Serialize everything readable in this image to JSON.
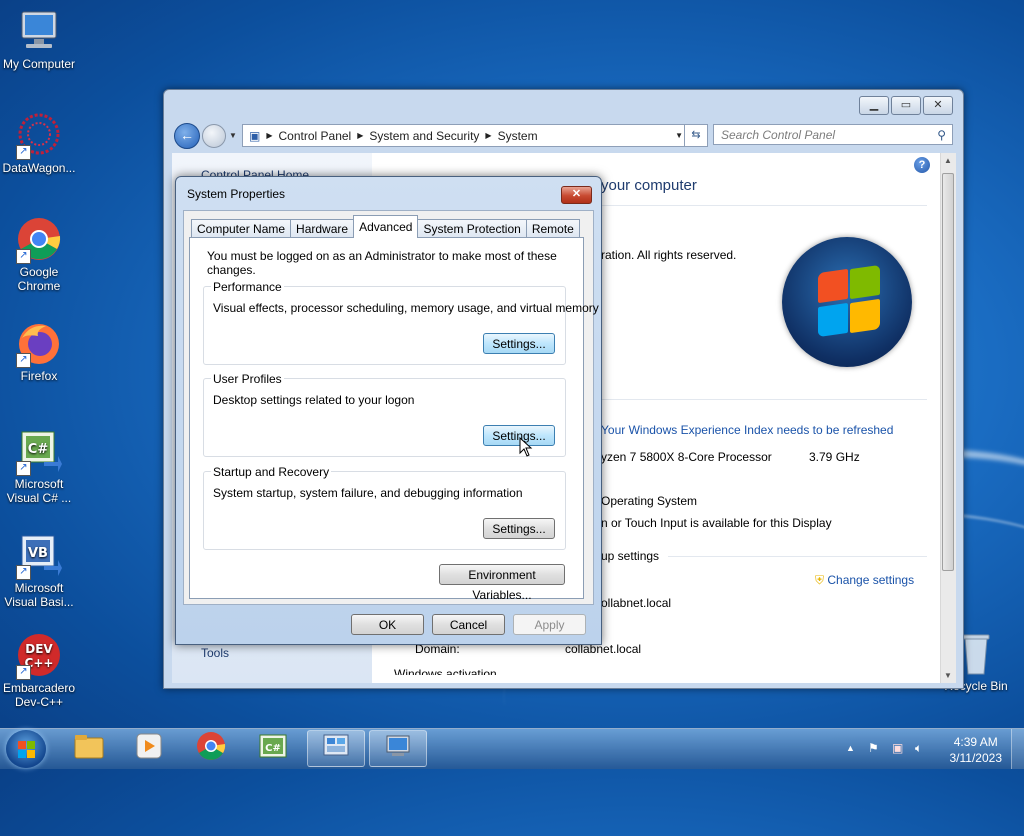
{
  "desktop": {
    "icons": [
      {
        "label": "My Computer"
      },
      {
        "label": "DataWagon..."
      },
      {
        "label": "Google Chrome"
      },
      {
        "label": "Firefox"
      },
      {
        "label": "Microsoft Visual C# ..."
      },
      {
        "label": "Microsoft Visual Basi..."
      },
      {
        "label": "Embarcadero Dev-C++"
      },
      {
        "label": "Recycle Bin"
      }
    ]
  },
  "control_panel": {
    "breadcrumbs": [
      "Control Panel",
      "System and Security",
      "System"
    ],
    "search_placeholder": "Search Control Panel",
    "left": {
      "home": "Control Panel Home",
      "tools": "Tools"
    },
    "main": {
      "title_partial": "your computer",
      "copyright_partial": "ration.  All rights reserved.",
      "wei_link": "Your Windows Experience Index needs to be refreshed",
      "processor": "yzen 7 5800X 8-Core Processor",
      "processor_speed": "3.79 GHz",
      "os_type": "Operating System",
      "pen_touch": "n or Touch Input is available for this Display",
      "section_settings": "up settings",
      "change_settings": "Change settings",
      "domain_partial": "ollabnet.local",
      "domain_label": "Domain:",
      "domain_value": "collabnet.local",
      "activation_partial": "Windows activation"
    }
  },
  "dialog": {
    "title": "System Properties",
    "close": "✕",
    "tabs": [
      "Computer Name",
      "Hardware",
      "Advanced",
      "System Protection",
      "Remote"
    ],
    "active_tab": "Advanced",
    "note": "You must be logged on as an Administrator to make most of these changes.",
    "performance": {
      "title": "Performance",
      "desc": "Visual effects, processor scheduling, memory usage, and virtual memory",
      "button": "Settings..."
    },
    "user_profiles": {
      "title": "User Profiles",
      "desc": "Desktop settings related to your logon",
      "button": "Settings..."
    },
    "startup": {
      "title": "Startup and Recovery",
      "desc": "System startup, system failure, and debugging information",
      "button": "Settings..."
    },
    "env_button": "Environment Variables...",
    "ok": "OK",
    "cancel": "Cancel",
    "apply": "Apply"
  },
  "taskbar": {
    "time": "4:39 AM",
    "date": "3/11/2023"
  }
}
